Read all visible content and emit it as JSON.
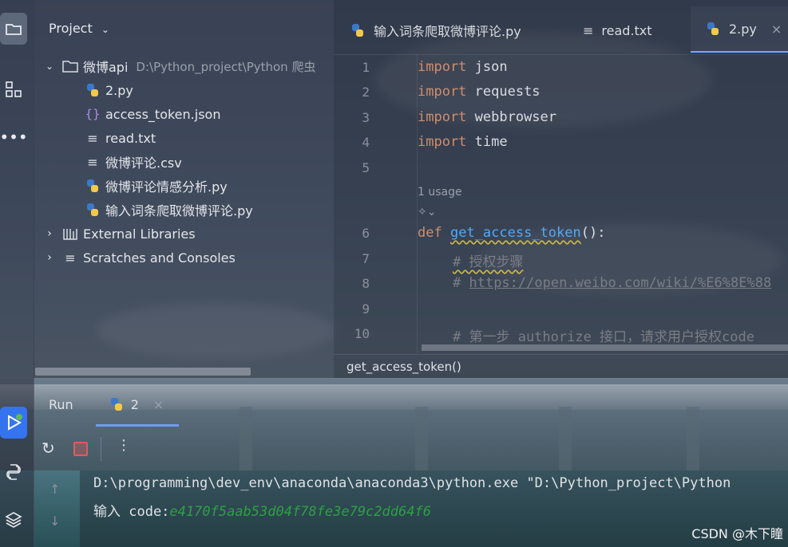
{
  "project": {
    "title": "Project",
    "root_name": "微博api",
    "root_path": "D:\\Python_project\\Python 爬虫",
    "files": [
      "2.py",
      "access_token.json",
      "read.txt",
      "微博评论.csv",
      "微博评论情感分析.py",
      "输入词条爬取微博评论.py"
    ],
    "external_libraries": "External Libraries",
    "scratches": "Scratches and Consoles"
  },
  "tabs": [
    {
      "label": "输入词条爬取微博评论.py",
      "icon": "python-icon"
    },
    {
      "label": "read.txt",
      "icon": "text-file-icon"
    },
    {
      "label": "2.py",
      "icon": "python-icon",
      "active": true
    }
  ],
  "editor": {
    "line_numbers": [
      "1",
      "2",
      "3",
      "4",
      "5",
      "6",
      "7",
      "8",
      "9",
      "10"
    ],
    "usage_hint": "1 usage",
    "code": {
      "l1_kw": "import",
      "l1_rest": " json",
      "l2_kw": "import",
      "l2_rest": " requests",
      "l3_kw": "import",
      "l3_rest": " webbrowser",
      "l4_kw": "import",
      "l4_rest": " time",
      "l6_kw": "def",
      "l6_fn": "get_access_token",
      "l6_rest": "():",
      "l7": "# 授权步骤",
      "l8_prefix": "# ",
      "l8_link": "https://open.weibo.com/wiki/%E6%8E%88",
      "l10": "# 第一步 authorize 接口，请求用户授权code"
    },
    "breadcrumb": "get_access_token()"
  },
  "run": {
    "label": "Run",
    "tab_label": "2",
    "console_line1": "D:\\programming\\dev_env\\anaconda\\anaconda3\\python.exe \"D:\\Python_project\\Python",
    "console_prompt": "输入 code:",
    "console_input": "e4170f5aab53d04f78fe3e79c2dd64f6"
  },
  "watermark": "CSDN @木下瞳"
}
